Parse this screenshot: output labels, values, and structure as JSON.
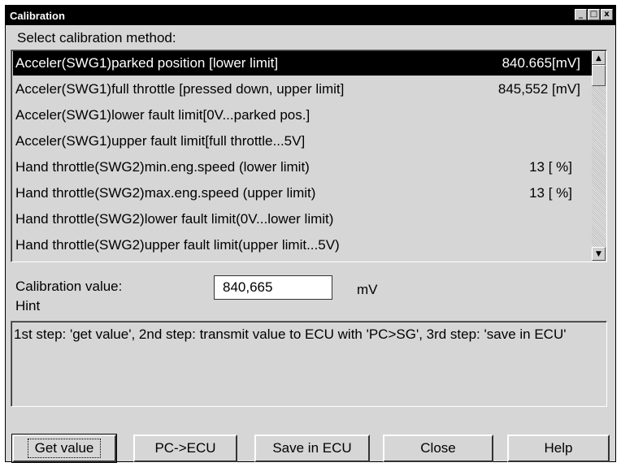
{
  "window": {
    "title": "Calibration",
    "min": "_",
    "max": "□",
    "close": "x"
  },
  "select_label": "Select calibration method:",
  "list": [
    {
      "label": "Acceler(SWG1)parked position [lower limit]",
      "value": "840.665[mV]",
      "selected": true
    },
    {
      "label": "Acceler(SWG1)full throttle [pressed down, upper limit]",
      "value": "845,552 [mV]"
    },
    {
      "label": "Acceler(SWG1)lower fault limit[0V...parked pos.]",
      "value": ""
    },
    {
      "label": "Acceler(SWG1)upper fault limit[full throttle...5V]",
      "value": ""
    },
    {
      "label": "Hand throttle(SWG2)min.eng.speed (lower limit)",
      "value": "13 [ %]"
    },
    {
      "label": "Hand throttle(SWG2)max.eng.speed (upper limit)",
      "value": "13 [ %]"
    },
    {
      "label": "Hand throttle(SWG2)lower fault limit(0V...lower limit)",
      "value": ""
    },
    {
      "label": "Hand throttle(SWG2)upper fault limit(upper limit...5V)",
      "value": ""
    }
  ],
  "calibration": {
    "label": "Calibration value:",
    "value": "840,665",
    "unit": "mV"
  },
  "hint": {
    "label": "Hint",
    "text": "1st step: 'get value', 2nd step: transmit value to ECU with 'PC>SG', 3rd step: 'save in ECU'"
  },
  "buttons": {
    "get_value": "Get value",
    "pc_ecu": "PC->ECU",
    "save": "Save in ECU",
    "close": "Close",
    "help": "Help"
  },
  "icons": {
    "scroll_up": "▲",
    "scroll_down": "▼"
  }
}
